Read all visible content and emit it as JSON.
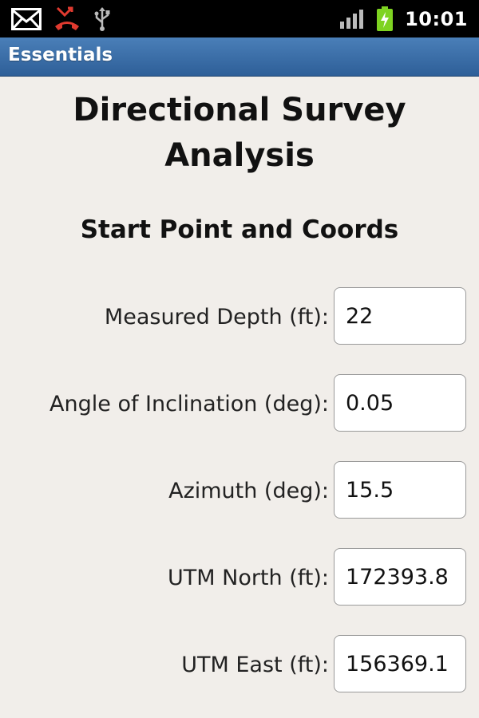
{
  "status_bar": {
    "time": "10:01",
    "icons": [
      "email-icon",
      "missed-call-icon",
      "usb-icon",
      "signal-icon",
      "battery-charging-icon"
    ]
  },
  "app_bar": {
    "title": "Essentials"
  },
  "page": {
    "title": "Directional Survey Analysis",
    "section_title": "Start Point and Coords"
  },
  "form": {
    "fields": [
      {
        "label": "Measured Depth (ft):",
        "value": "22"
      },
      {
        "label": "Angle of Inclination (deg):",
        "value": "0.05"
      },
      {
        "label": "Azimuth (deg):",
        "value": "15.5"
      },
      {
        "label": "UTM North (ft):",
        "value": "172393.8"
      },
      {
        "label": "UTM East (ft):",
        "value": "156369.1"
      }
    ]
  },
  "colors": {
    "status_bar_bg": "#000000",
    "title_bar_bg": "#3a6ea8",
    "content_bg": "#f1eeea",
    "missed_call_icon": "#e03a2f",
    "battery_icon": "#7ed321"
  }
}
